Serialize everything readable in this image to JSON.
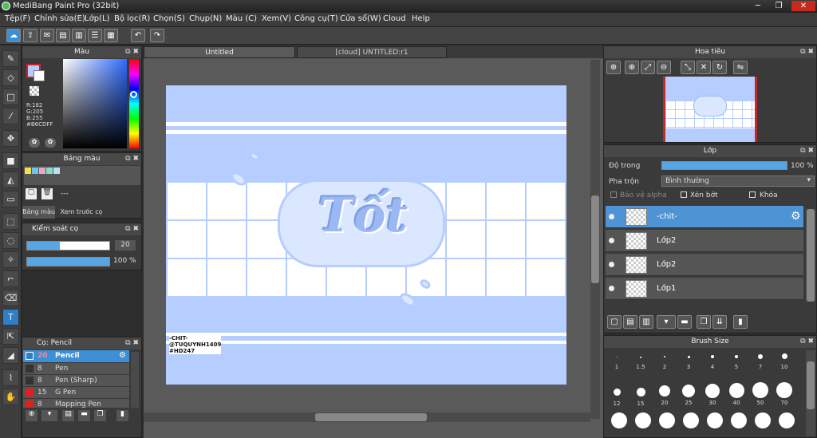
{
  "window": {
    "title": "MediBang Paint Pro (32bit)"
  },
  "menu": [
    "Tệp(F)",
    "Chỉnh sửa(E)",
    "Lớp(L)",
    "Bộ lọc(R)",
    "Chọn(S)",
    "Chụp(N)",
    "Màu (C)",
    "Xem(V)",
    "Công cụ(T)",
    "Cửa sổ(W)",
    "Cloud",
    "Help"
  ],
  "tabs": {
    "tab1": "Untitled",
    "tab2": "[cloud] UNTITLED:r1"
  },
  "color_panel": {
    "title": "Màu",
    "r": "R:182",
    "g": "G:205",
    "b": "B:255",
    "hex": "#B6CDFF",
    "main_color": "#B6CDFF"
  },
  "palette_panel": {
    "title": "Bảng màu",
    "dash": "---",
    "tab1": "Bảng màu",
    "tab2": "Xem trước cọ"
  },
  "brush_control": {
    "title": "Kiểm soát cọ",
    "size": "20",
    "opacity": "100 %",
    "size_fraction": 0.4,
    "opacity_fraction": 1.0
  },
  "brush_panel": {
    "title": "Cọ: Pencil",
    "items": [
      {
        "size": "20",
        "name": "Pencil",
        "color": "#2f7fc8"
      },
      {
        "size": "8",
        "name": "Pen",
        "color": "#333333"
      },
      {
        "size": "8",
        "name": "Pen (Sharp)",
        "color": "#333333"
      },
      {
        "size": "15",
        "name": "G Pen",
        "color": "#e02020"
      },
      {
        "size": "8",
        "name": "Mapping Pen",
        "color": "#e02020"
      }
    ]
  },
  "navigator": {
    "title": "Hoa tiêu"
  },
  "layers": {
    "title": "Lớp",
    "opacity_label": "Độ trong",
    "opacity_value": "100 %",
    "opacity_fraction": 1.0,
    "blend_label": "Pha trộn",
    "blend_value": "Bình thường",
    "protect_alpha": "Bảo vệ alpha",
    "clip": "Xén bớt",
    "lock": "Khóa",
    "items": [
      {
        "name": "-chit-"
      },
      {
        "name": "Lớp2"
      },
      {
        "name": "Lớp2"
      },
      {
        "name": "Lớp1"
      }
    ]
  },
  "brush_size": {
    "title": "Brush Size",
    "row1": [
      "1",
      "1.5",
      "2",
      "3",
      "4",
      "5",
      "7",
      "10"
    ],
    "row2": [
      "12",
      "15",
      "20",
      "25",
      "30",
      "40",
      "50",
      "70"
    ]
  },
  "artwork": {
    "title_text": "Tốt",
    "signature_line1": "-CHIT-",
    "signature_line2": "@TUQUYNH1409",
    "signature_line3": "#HD247",
    "accent": "#B6CDFF"
  }
}
